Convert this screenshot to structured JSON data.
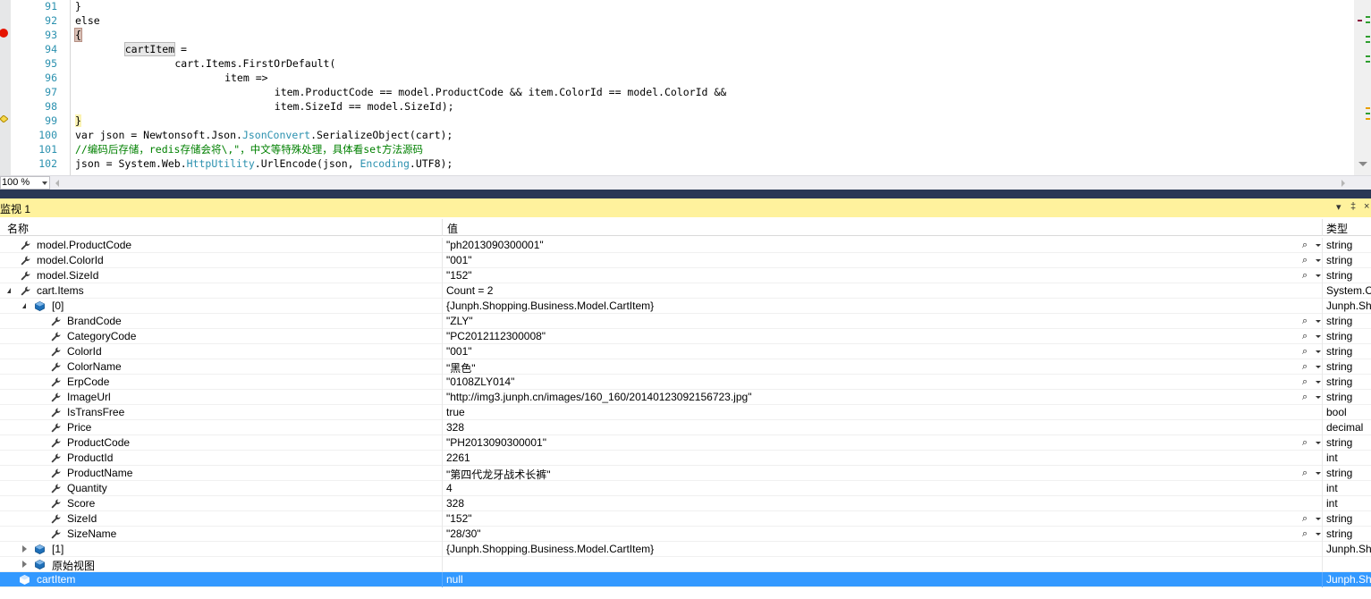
{
  "editor": {
    "line_numbers": [
      "91",
      "92",
      "93",
      "94",
      "95",
      "96",
      "97",
      "98",
      "99",
      "100",
      "101",
      "102"
    ],
    "lines": [
      "}",
      "else",
      "{",
      "    cartItem =",
      "        cart.Items.FirstOrDefault(",
      "            item =>",
      "                item.ProductCode == model.ProductCode && item.ColorId == model.ColorId &&",
      "                item.SizeId == model.SizeId);",
      "}",
      "var json = Newtonsoft.Json.JsonConvert.SerializeObject(cart);",
      "//编码后存储，redis存储会将\\,\"，中文等特殊处理，具体看set方法源码",
      "json = System.Web.HttpUtility.UrlEncode(json, Encoding.UTF8);"
    ],
    "type_names": [
      "JsonConvert",
      "HttpUtility",
      "Encoding"
    ],
    "zoom": "100 %"
  },
  "watch": {
    "title": "监视 1",
    "title_buttons": [
      "▾",
      "‡",
      "×"
    ],
    "columns": {
      "name": "名称",
      "value": "值",
      "type": "类型"
    },
    "rows": [
      {
        "name": "model.ProductCode",
        "value": "\"ph2013090300001\"",
        "type": "string",
        "indent": 0,
        "icon": "wrench-icon",
        "expander": "none",
        "magnifier": true
      },
      {
        "name": "model.ColorId",
        "value": "\"001\"",
        "type": "string",
        "indent": 0,
        "icon": "wrench-icon",
        "expander": "none",
        "magnifier": true
      },
      {
        "name": "model.SizeId",
        "value": "\"152\"",
        "type": "string",
        "indent": 0,
        "icon": "wrench-icon",
        "expander": "none",
        "magnifier": true
      },
      {
        "name": "cart.Items",
        "value": "Count = 2",
        "type": "System.C",
        "indent": 0,
        "icon": "wrench-icon",
        "expander": "open",
        "magnifier": false
      },
      {
        "name": "[0]",
        "value": "{Junph.Shopping.Business.Model.CartItem}",
        "type": "Junph.Sh",
        "indent": 1,
        "icon": "object-icon",
        "expander": "open",
        "magnifier": false
      },
      {
        "name": "BrandCode",
        "value": "\"ZLY\"",
        "type": "string",
        "indent": 2,
        "icon": "wrench-icon",
        "expander": "none",
        "magnifier": true
      },
      {
        "name": "CategoryCode",
        "value": "\"PC2012112300008\"",
        "type": "string",
        "indent": 2,
        "icon": "wrench-icon",
        "expander": "none",
        "magnifier": true
      },
      {
        "name": "ColorId",
        "value": "\"001\"",
        "type": "string",
        "indent": 2,
        "icon": "wrench-icon",
        "expander": "none",
        "magnifier": true
      },
      {
        "name": "ColorName",
        "value": "\"黑色\"",
        "type": "string",
        "indent": 2,
        "icon": "wrench-icon",
        "expander": "none",
        "magnifier": true
      },
      {
        "name": "ErpCode",
        "value": "\"0108ZLY014\"",
        "type": "string",
        "indent": 2,
        "icon": "wrench-icon",
        "expander": "none",
        "magnifier": true
      },
      {
        "name": "ImageUrl",
        "value": "\"http://img3.junph.cn/images/160_160/20140123092156723.jpg\"",
        "type": "string",
        "indent": 2,
        "icon": "wrench-icon",
        "expander": "none",
        "magnifier": true
      },
      {
        "name": "IsTransFree",
        "value": "true",
        "type": "bool",
        "indent": 2,
        "icon": "wrench-icon",
        "expander": "none",
        "magnifier": false
      },
      {
        "name": "Price",
        "value": "328",
        "type": "decimal",
        "indent": 2,
        "icon": "wrench-icon",
        "expander": "none",
        "magnifier": false
      },
      {
        "name": "ProductCode",
        "value": "\"PH2013090300001\"",
        "type": "string",
        "indent": 2,
        "icon": "wrench-icon",
        "expander": "none",
        "magnifier": true
      },
      {
        "name": "ProductId",
        "value": "2261",
        "type": "int",
        "indent": 2,
        "icon": "wrench-icon",
        "expander": "none",
        "magnifier": false
      },
      {
        "name": "ProductName",
        "value": "\"第四代龙牙战术长裤\"",
        "type": "string",
        "indent": 2,
        "icon": "wrench-icon",
        "expander": "none",
        "magnifier": true
      },
      {
        "name": "Quantity",
        "value": "4",
        "type": "int",
        "indent": 2,
        "icon": "wrench-icon",
        "expander": "none",
        "magnifier": false
      },
      {
        "name": "Score",
        "value": "328",
        "type": "int",
        "indent": 2,
        "icon": "wrench-icon",
        "expander": "none",
        "magnifier": false
      },
      {
        "name": "SizeId",
        "value": "\"152\"",
        "type": "string",
        "indent": 2,
        "icon": "wrench-icon",
        "expander": "none",
        "magnifier": true
      },
      {
        "name": "SizeName",
        "value": "\"28/30\"",
        "type": "string",
        "indent": 2,
        "icon": "wrench-icon",
        "expander": "none",
        "magnifier": true
      },
      {
        "name": "[1]",
        "value": "{Junph.Shopping.Business.Model.CartItem}",
        "type": "Junph.Sh",
        "indent": 1,
        "icon": "object-icon",
        "expander": "closed",
        "magnifier": false
      },
      {
        "name": "原始视图",
        "value": "",
        "type": "",
        "indent": 1,
        "icon": "object-icon",
        "expander": "closed",
        "magnifier": false
      },
      {
        "name": "cartItem",
        "value": "null",
        "type": "Junph.Sh",
        "indent": 0,
        "icon": "object-icon",
        "expander": "none",
        "magnifier": false,
        "selected": true
      }
    ]
  },
  "colors": {
    "line_number": "#2b91af",
    "type_name": "#2b91af",
    "comment": "#008000",
    "watch_title_bg": "#fff29d",
    "selection": "#3399ff",
    "breakpoint": "#e51400",
    "splitter": "#293955"
  }
}
